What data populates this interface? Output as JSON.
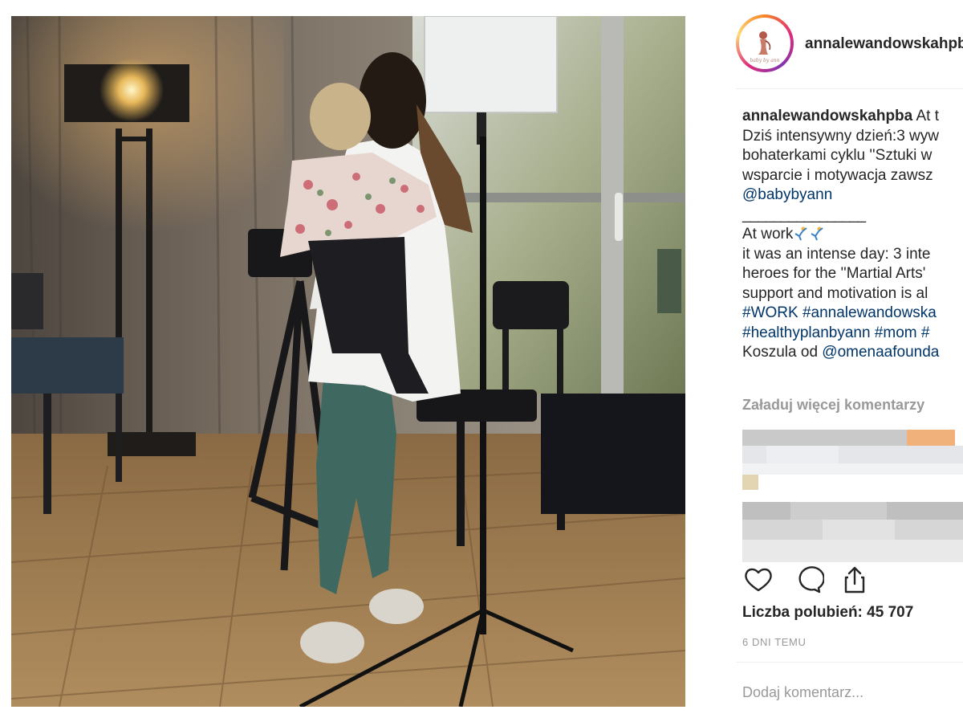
{
  "post": {
    "username": "annalewandowskahpba",
    "avatar_icon": "baby-by-ann-logo",
    "avatar_ring_colors": [
      "#f58529",
      "#dd2a7b",
      "#8134af",
      "#feda77"
    ]
  },
  "caption": {
    "author": "annalewandowskahpba",
    "line1_rest": " At t",
    "line2": "Dziś intensywny dzień:3 wyw",
    "line3": "bohaterkami cyklu ''Sztuki w",
    "line4": "wsparcie i motywacja zawsz",
    "mention1": "@babybyann",
    "separator": "________________",
    "line7": "At work",
    "line8": "it was an intense day: 3 inte",
    "line9": "heroes for the ''Martial Arts'",
    "line10": "support and motivation is al",
    "hashtags1": "#WORK #annalewandowska",
    "hashtags2": "#healthyplanbyann #mom #",
    "shirt_prefix": "Koszula od ",
    "mention2": "@omenaafounda"
  },
  "comments": {
    "load_more": "Załaduj więcej komentarzy"
  },
  "actions": {
    "like_icon": "heart-icon",
    "comment_icon": "comment-icon",
    "share_icon": "share-icon"
  },
  "likes_text": "Liczba polubień: 45 707",
  "time_text": "6 DNI TEMU",
  "add_comment_placeholder": "Dodaj komentarz...",
  "colors": {
    "link": "#003569",
    "muted": "#999999",
    "text": "#262626"
  }
}
